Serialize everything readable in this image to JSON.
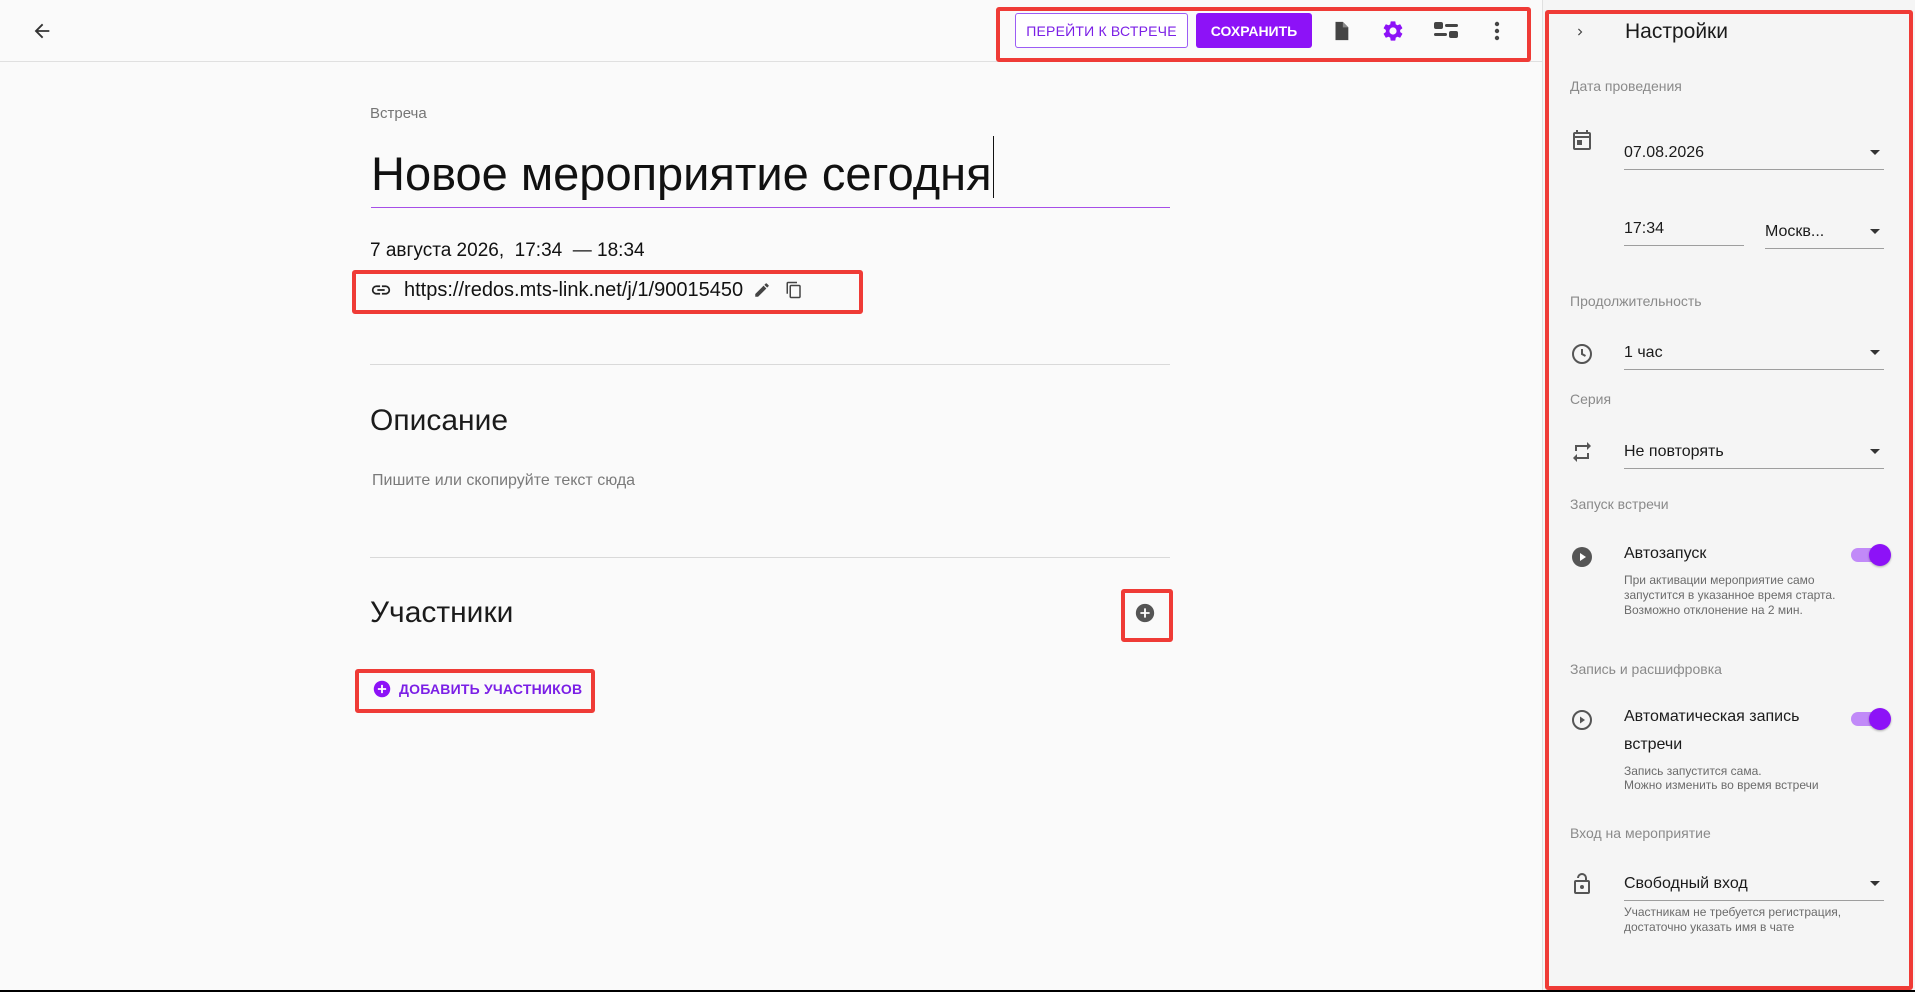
{
  "header": {
    "goto_meeting_label": "ПЕРЕЙТИ К ВСТРЕЧЕ",
    "save_label": "СОХРАНИТЬ",
    "icons": [
      "back-arrow-icon",
      "document-icon",
      "gear-icon",
      "layout-toggle-icon",
      "more-vertical-icon"
    ]
  },
  "event": {
    "kicker": "Встреча",
    "title": "Новое мероприятие сегодня",
    "datetime": "7 августа 2026,  17:34  — 18:34",
    "link": "https://redos.mts-link.net/j/1/90015450"
  },
  "description": {
    "heading": "Описание",
    "placeholder": "Пишите или скопируйте текст сюда"
  },
  "participants": {
    "heading": "Участники",
    "add_label": "ДОБАВИТЬ УЧАСТНИКОВ"
  },
  "settings": {
    "title": "Настройки",
    "date_section": "Дата проведения",
    "date_value": "07.08.2026",
    "time_value": "17:34",
    "timezone_value": "Москв...",
    "duration_section": "Продолжительность",
    "duration_value": "1 час",
    "series_section": "Серия",
    "series_value": "Не повторять",
    "launch_section": "Запуск встречи",
    "autostart_label": "Автозапуск",
    "autostart_on": true,
    "autostart_hint": "При активации мероприятие само запустится в указанное время старта. Возможно отклонение на 2 мин.",
    "recording_section": "Запись и расшифровка",
    "autorecord_label": "Автоматическая запись встречи",
    "autorecord_on": true,
    "autorecord_hint_1": "Запись запустится сама.",
    "autorecord_hint_2": "Можно изменить во время встречи",
    "entry_section": "Вход на мероприятие",
    "entry_value": "Свободный вход",
    "entry_hint": "Участникам не требуется регистрация, достаточно указать имя в чате"
  },
  "colors": {
    "accent": "#8d12f7",
    "highlight_box": "#ef3b36"
  }
}
